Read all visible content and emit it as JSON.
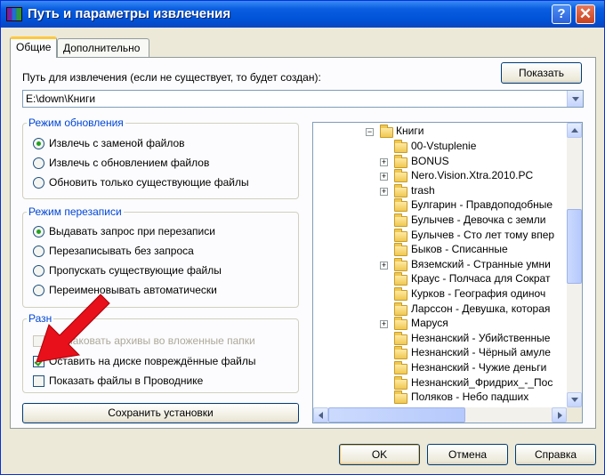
{
  "window": {
    "title": "Путь и параметры извлечения",
    "help_glyph": "?",
    "close_glyph": "✕"
  },
  "tabs": [
    {
      "label": "Общие",
      "active": true
    },
    {
      "label": "Дополнительно",
      "active": false
    }
  ],
  "path": {
    "label": "Путь для извлечения (если не существует, то будет создан):",
    "value": "E:\\down\\Книги",
    "show_button": "Показать"
  },
  "update_mode": {
    "title": "Режим обновления",
    "options": [
      {
        "label": "Извлечь с заменой файлов",
        "selected": true
      },
      {
        "label": "Извлечь с обновлением файлов",
        "selected": false
      },
      {
        "label": "Обновить только существующие файлы",
        "selected": false
      }
    ]
  },
  "overwrite_mode": {
    "title": "Режим перезаписи",
    "options": [
      {
        "label": "Выдавать запрос при перезаписи",
        "selected": true
      },
      {
        "label": "Перезаписывать без запроса",
        "selected": false
      },
      {
        "label": "Пропускать существующие файлы",
        "selected": false
      },
      {
        "label": "Переименовывать автоматически",
        "selected": false
      }
    ]
  },
  "misc": {
    "title": "Разн",
    "options": [
      {
        "label": "Распаковать архивы во вложенные папки",
        "checked": false,
        "disabled": true
      },
      {
        "label": "Оставить на диске повреждённые файлы",
        "checked": true,
        "disabled": false
      },
      {
        "label": "Показать файлы в Проводнике",
        "checked": false,
        "disabled": false
      }
    ]
  },
  "save_button": "Сохранить установки",
  "folder_tree": {
    "root": "Книги",
    "items": [
      {
        "label": "00-Vstuplenie",
        "expandable": false
      },
      {
        "label": "BONUS",
        "expandable": true
      },
      {
        "label": "Nero.Vision.Xtra.2010.PC",
        "expandable": true
      },
      {
        "label": "trash",
        "expandable": true
      },
      {
        "label": "Булгарин - Правдоподобные",
        "expandable": false
      },
      {
        "label": "Булычев - Девочка с земли",
        "expandable": false
      },
      {
        "label": "Булычев - Сто лет тому впер",
        "expandable": false
      },
      {
        "label": "Быков - Списанные",
        "expandable": false
      },
      {
        "label": "Вяземский - Странные умни",
        "expandable": true
      },
      {
        "label": "Краус - Полчаса для Сократ",
        "expandable": false
      },
      {
        "label": "Курков - География одиноч",
        "expandable": false
      },
      {
        "label": "Ларссон - Девушка, которая",
        "expandable": false
      },
      {
        "label": "Маруся",
        "expandable": true
      },
      {
        "label": "Незнанский - Убийственные",
        "expandable": false
      },
      {
        "label": "Незнанский - Чёрный амуле",
        "expandable": false
      },
      {
        "label": "Незнанский - Чужие деньги",
        "expandable": false
      },
      {
        "label": "Незнанский_Фридрих_-_Пос",
        "expandable": false
      },
      {
        "label": "Поляков - Небо падших",
        "expandable": false
      }
    ]
  },
  "footer": {
    "ok": "OK",
    "cancel": "Отмена",
    "help": "Справка"
  },
  "colors": {
    "title_bar": "#0052d6",
    "group_title": "#0046d5",
    "check_mark": "#21a121",
    "annotation_arrow": "#e8101a"
  }
}
